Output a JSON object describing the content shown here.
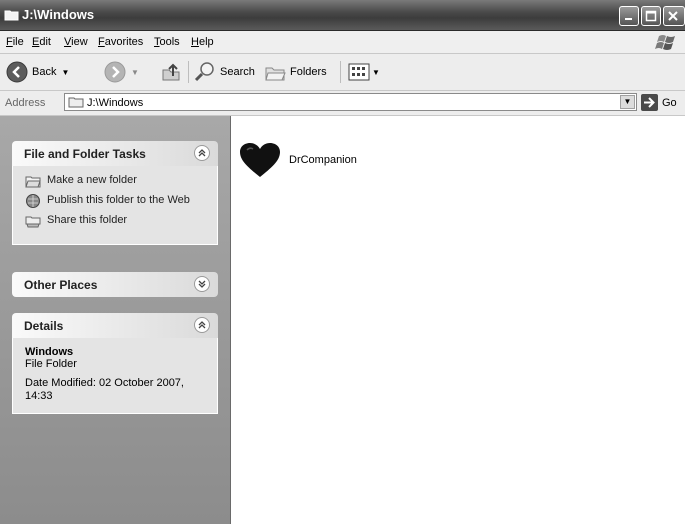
{
  "window": {
    "title": "J:\\Windows"
  },
  "menu": [
    "File",
    "Edit",
    "View",
    "Favorites",
    "Tools",
    "Help"
  ],
  "toolbar": {
    "back": "Back",
    "search": "Search",
    "folders": "Folders"
  },
  "address": {
    "label": "Address",
    "value": "J:\\Windows",
    "go": "Go"
  },
  "tasks_panel": {
    "title": "File and Folder Tasks",
    "items": [
      "Make a new folder",
      "Publish this folder to the Web",
      "Share this folder"
    ]
  },
  "other_places": {
    "title": "Other Places"
  },
  "details": {
    "title": "Details",
    "name": "Windows",
    "type": "File Folder",
    "date": "Date Modified: 02 October 2007, 14:33"
  },
  "files": [
    {
      "name": "DrCompanion",
      "icon": "heart-icon"
    }
  ]
}
